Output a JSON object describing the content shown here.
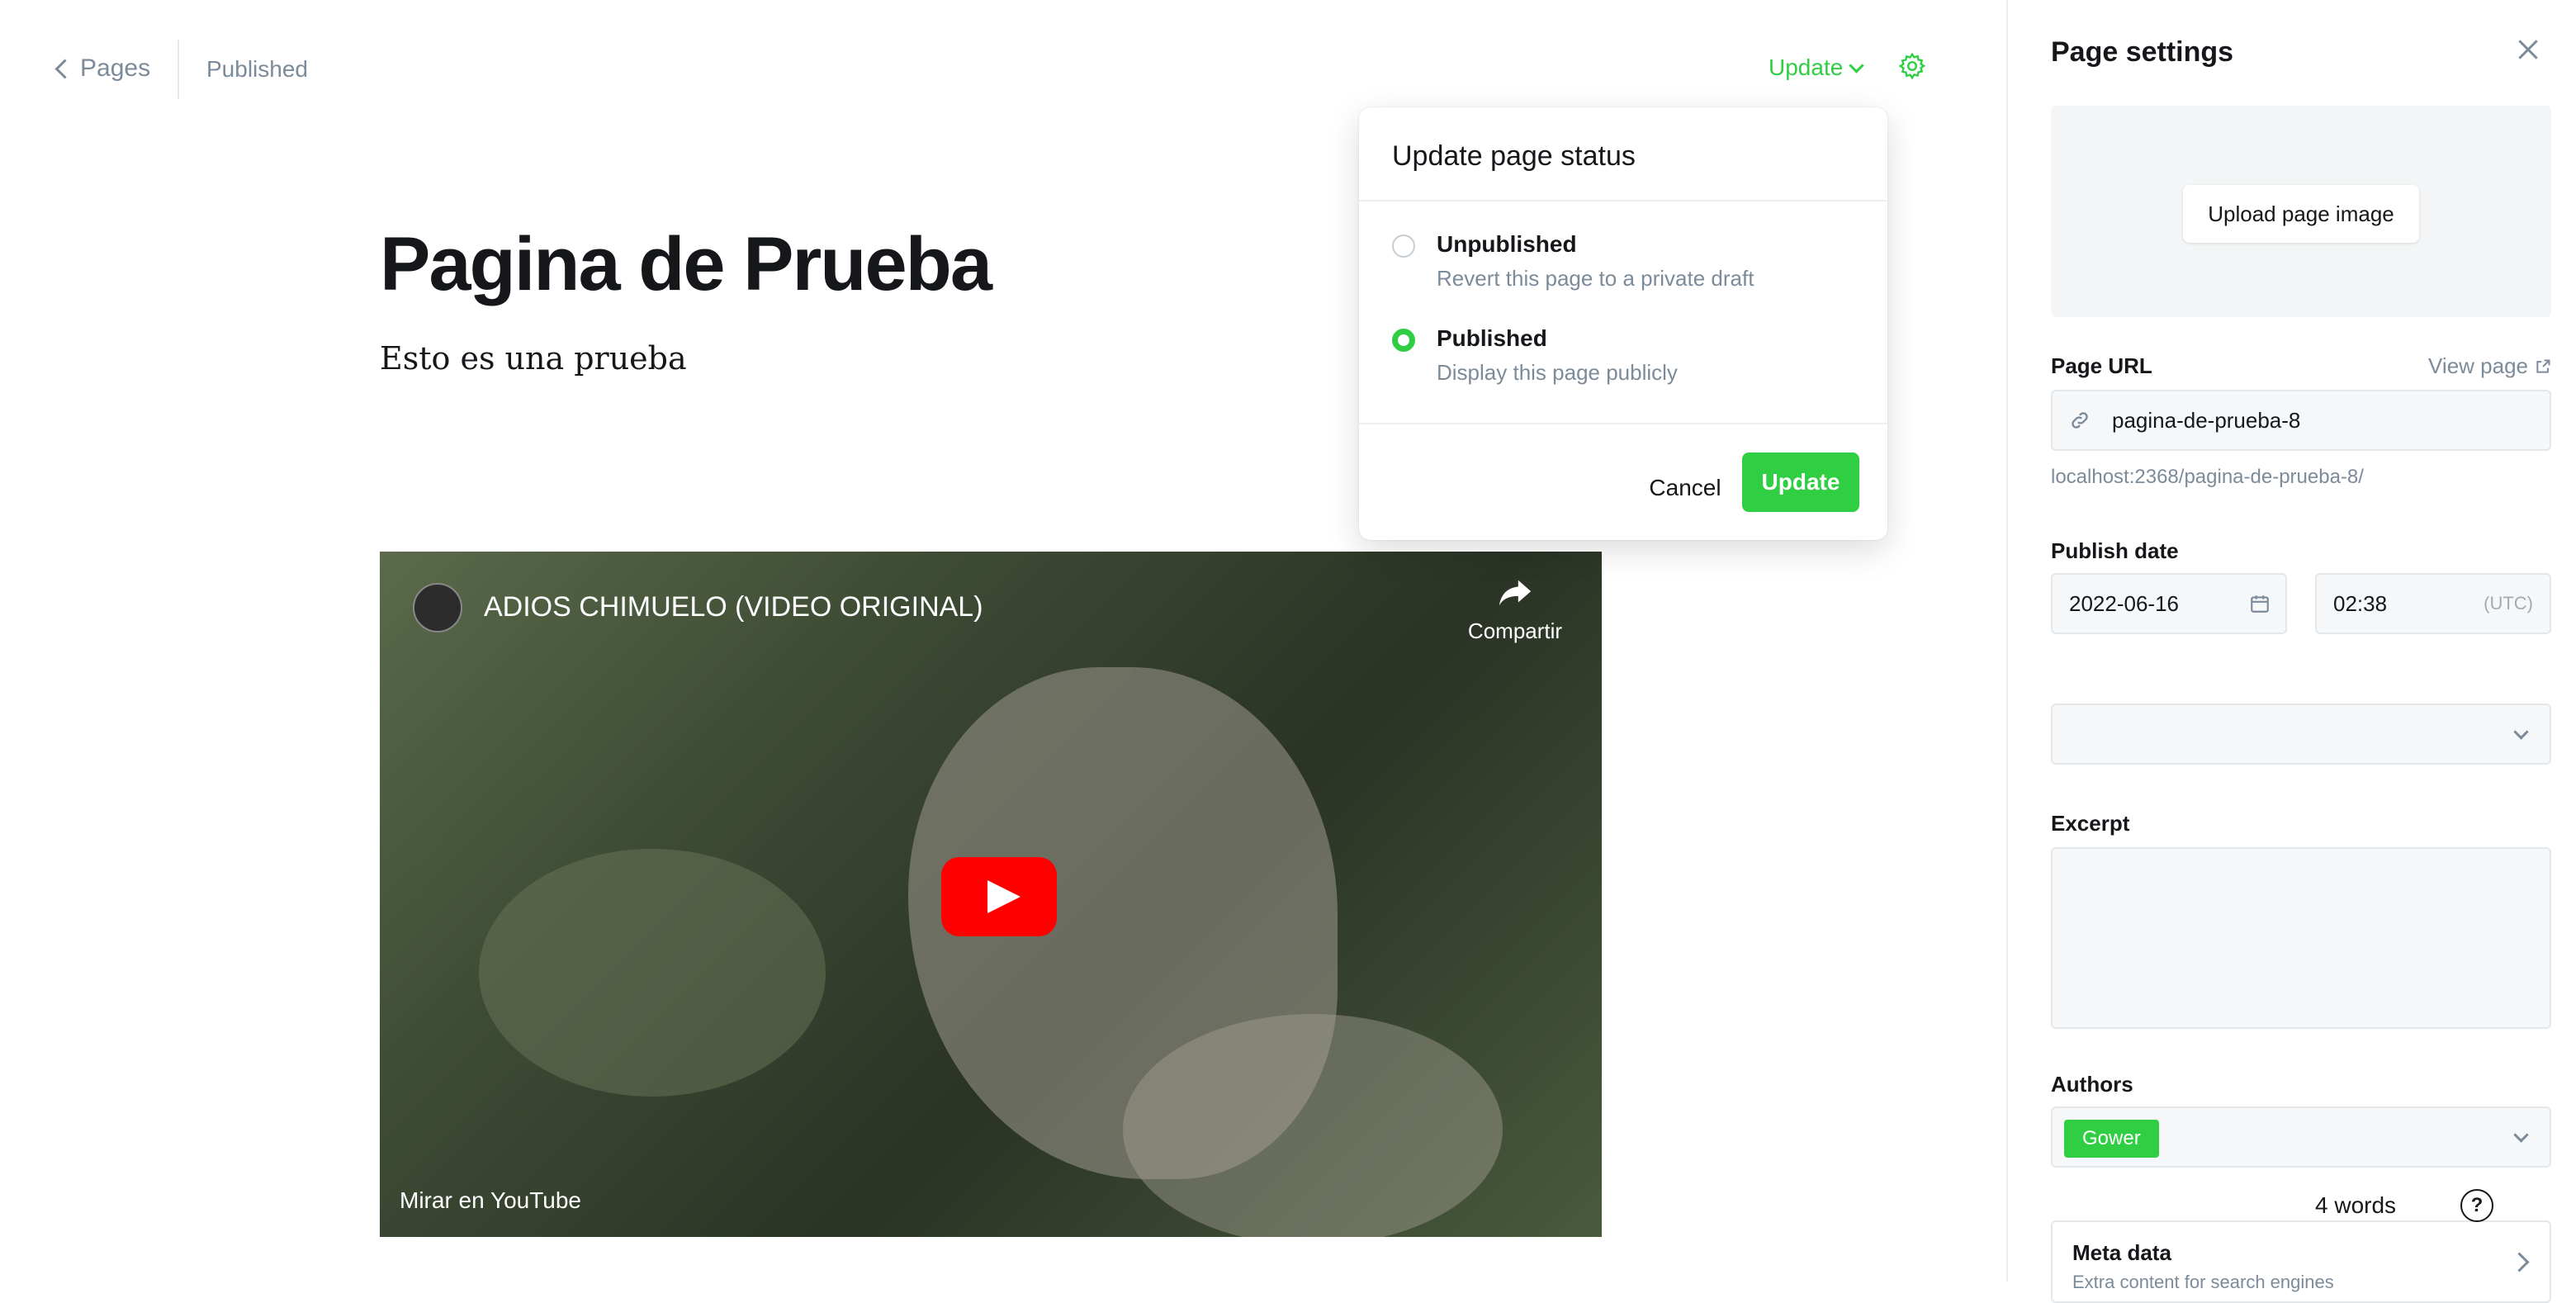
{
  "header": {
    "back_label": "Pages",
    "status": "Published",
    "update_menu_label": "Update"
  },
  "editor": {
    "title": "Pagina de Prueba",
    "paragraph": "Esto es una prueba"
  },
  "video": {
    "title": "ADIOS CHIMUELO (VIDEO ORIGINAL)",
    "share_label": "Compartir",
    "watch_on": "Mirar en YouTube"
  },
  "status_popup": {
    "title": "Update page status",
    "options": [
      {
        "label": "Unpublished",
        "description": "Revert this page to a private draft",
        "selected": false
      },
      {
        "label": "Published",
        "description": "Display this page publicly",
        "selected": true
      }
    ],
    "cancel_label": "Cancel",
    "update_label": "Update"
  },
  "settings": {
    "title": "Page settings",
    "upload_label": "Upload page image",
    "page_url_label": "Page URL",
    "view_page_label": "View page",
    "page_url_value": "pagina-de-prueba-8",
    "page_url_hint": "localhost:2368/pagina-de-prueba-8/",
    "publish_date_label": "Publish date",
    "date_value": "2022-06-16",
    "time_value": "02:38",
    "timezone": "(UTC)",
    "excerpt_label": "Excerpt",
    "authors_label": "Authors",
    "author_name": "Gower",
    "meta_title": "Meta data",
    "meta_desc": "Extra content for search engines"
  },
  "word_count": "4 words",
  "colors": {
    "accent": "#30cf43",
    "text": "#15171a",
    "muted": "#7c8b9a",
    "youtube_red": "#ff0000"
  }
}
